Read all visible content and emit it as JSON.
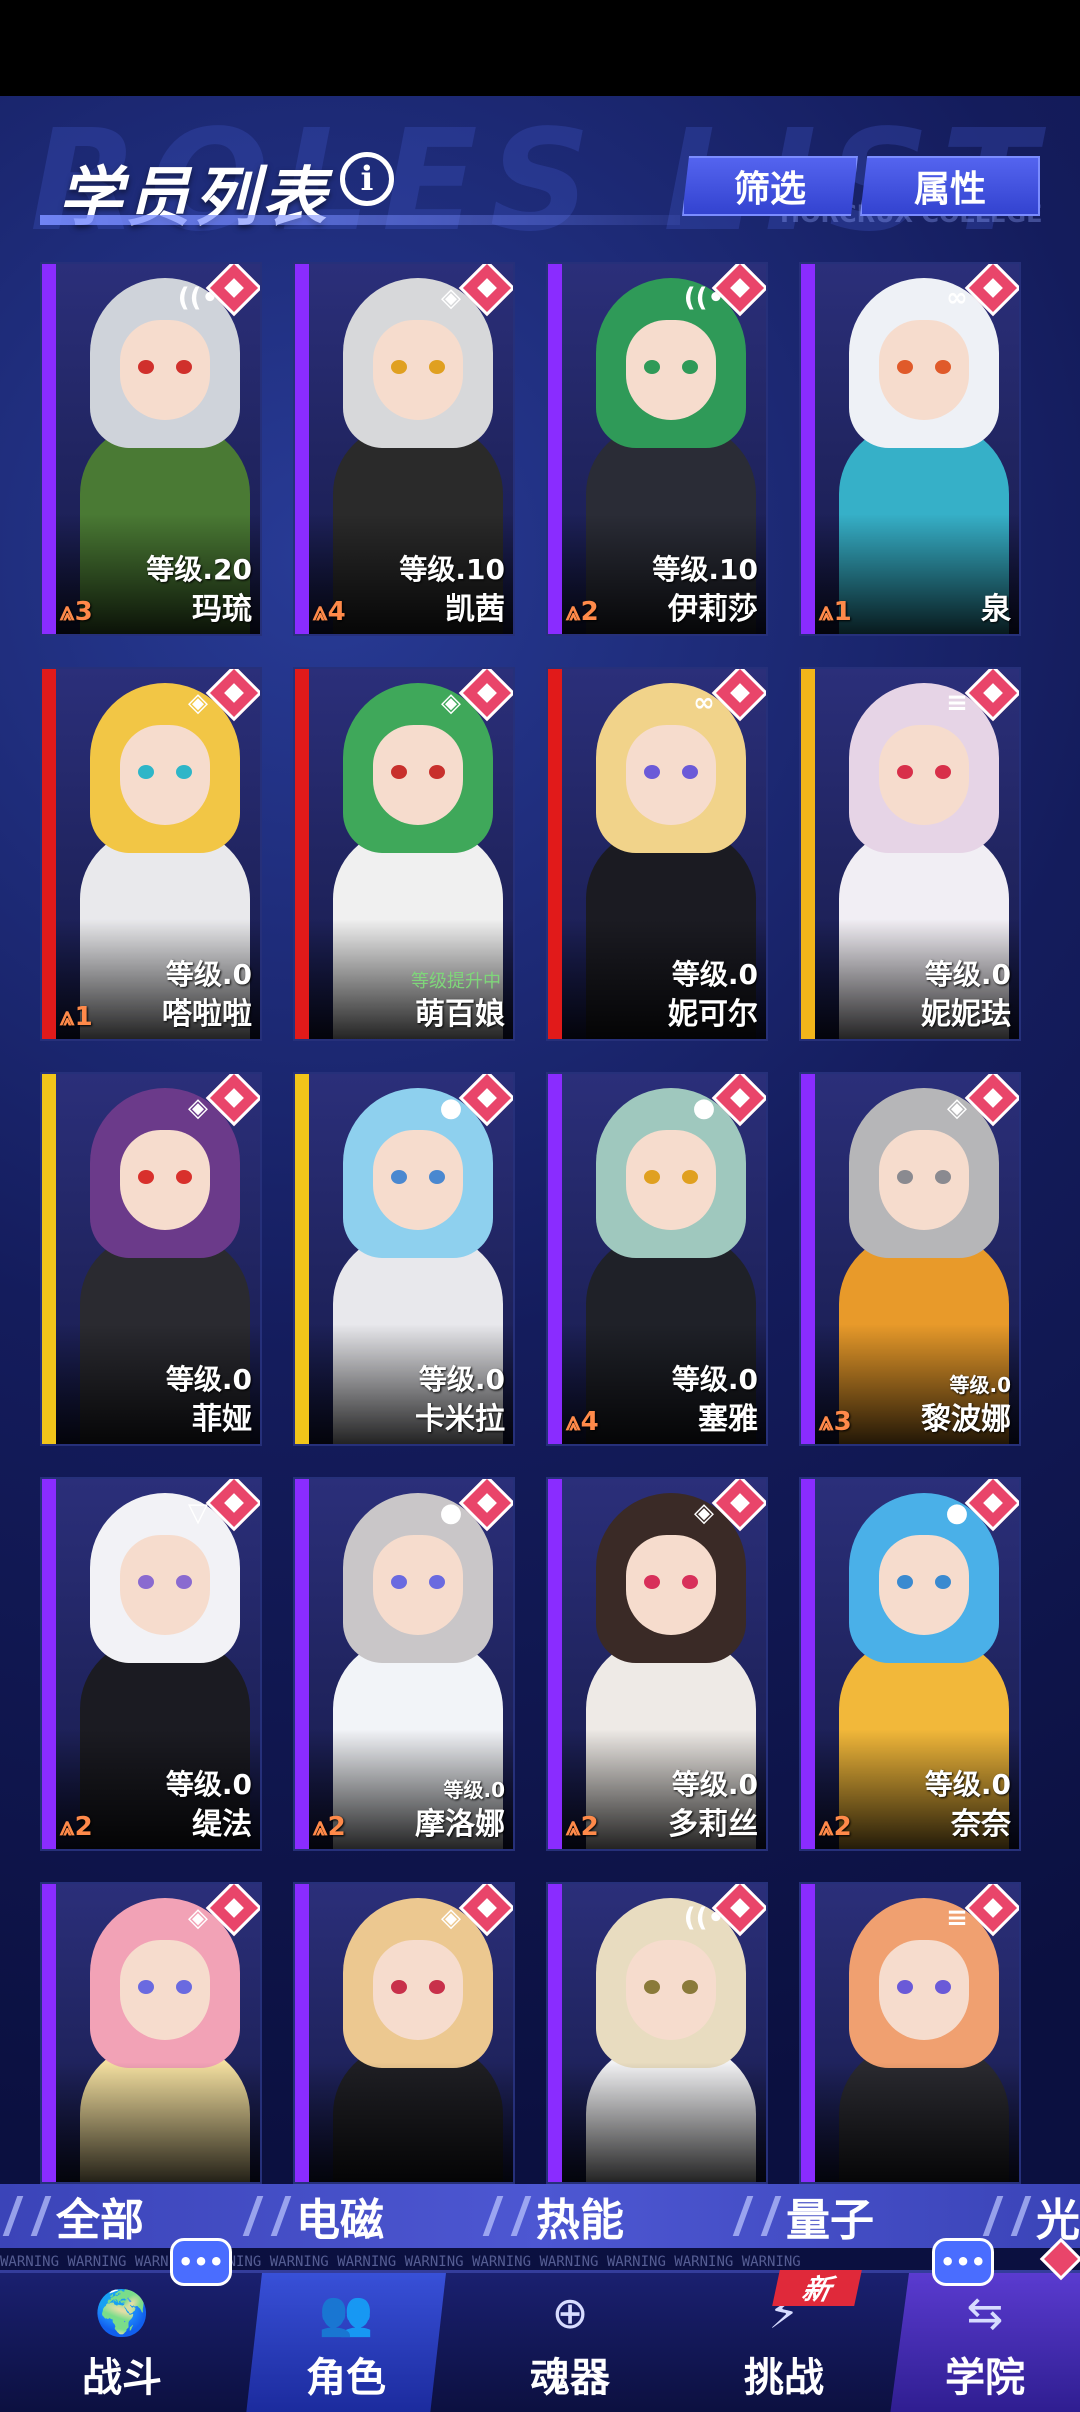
{
  "header": {
    "title": "学员列表",
    "filter_label": "筛选",
    "attribute_label": "属性",
    "bg_text": "ROLES LIST",
    "bg_college": "HORCRUX COLLEGE"
  },
  "characters": [
    {
      "name": "玛琉",
      "level": "等级.20",
      "rank": "⩓3",
      "element": "signal-icon",
      "element_glyph": "((•",
      "stripe": "#8a2cff",
      "hair": "#cfd3da",
      "eyes": "#d0302c",
      "outfit": "#4a7a34"
    },
    {
      "name": "凯茜",
      "level": "等级.10",
      "rank": "⩓4",
      "element": "diamond-icon",
      "element_glyph": "◈",
      "stripe": "#8a2cff",
      "hair": "#d7d8da",
      "eyes": "#e0a020",
      "outfit": "#2a2a2a"
    },
    {
      "name": "伊莉莎",
      "level": "等级.10",
      "rank": "⩓2",
      "element": "signal-icon",
      "element_glyph": "((•",
      "stripe": "#8a2cff",
      "hair": "#2f9a58",
      "eyes": "#2f9a58",
      "outfit": "#2a2c36"
    },
    {
      "name": "泉",
      "level": "",
      "rank": "⩓1",
      "element": "link-icon",
      "element_glyph": "∞",
      "stripe": "#8a2cff",
      "hair": "#eef1f6",
      "eyes": "#e05a2a",
      "outfit": "#36b0c8"
    },
    {
      "name": "嗒啦啦",
      "level": "等级.0",
      "rank": "⩓1",
      "element": "diamond-icon",
      "element_glyph": "◈",
      "stripe": "#e11a1a",
      "hair": "#f2c645",
      "eyes": "#2eb6c8",
      "outfit": "#e9e9ec"
    },
    {
      "name": "萌百娘",
      "level": "",
      "level_up_note": "等级提升中",
      "rank": "",
      "element": "diamond-icon",
      "element_glyph": "◈",
      "stripe": "#e11a1a",
      "hair": "#3fa85a",
      "eyes": "#c8302c",
      "outfit": "#f0f0f0"
    },
    {
      "name": "妮可尔",
      "level": "等级.0",
      "rank": "",
      "element": "link-icon",
      "element_glyph": "∞",
      "stripe": "#e11a1a",
      "hair": "#f1d38a",
      "eyes": "#6b5ad8",
      "outfit": "#1b1b22"
    },
    {
      "name": "妮妮珐",
      "level": "等级.0",
      "rank": "",
      "element": "bars-icon",
      "element_glyph": "≡",
      "stripe": "#f2b51a",
      "hair": "#e6d4e6",
      "eyes": "#d8304a",
      "outfit": "#f1eef4"
    },
    {
      "name": "菲娅",
      "level": "等级.0",
      "rank": "",
      "element": "diamond-icon",
      "element_glyph": "◈",
      "stripe": "#f2c51a",
      "hair": "#6b3a8a",
      "eyes": "#d8302c",
      "outfit": "#2a2a30"
    },
    {
      "name": "卡米拉",
      "level": "等级.0",
      "rank": "",
      "element": "drop-icon",
      "element_glyph": "●",
      "stripe": "#f2c51a",
      "hair": "#8ed0ee",
      "eyes": "#4a88d0",
      "outfit": "#e8e8ec"
    },
    {
      "name": "塞雅",
      "level": "等级.0",
      "rank": "⩓4",
      "element": "drop-icon",
      "element_glyph": "●",
      "stripe": "#8a2cff",
      "hair": "#9fc8be",
      "eyes": "#e0a020",
      "outfit": "#1f2128"
    },
    {
      "name": "黎波娜",
      "level": "等级.0",
      "rank": "⩓3",
      "element": "diamond-icon",
      "element_glyph": "◈",
      "stripe": "#8a2cff",
      "hair": "#b6b6b8",
      "eyes": "#8a8a90",
      "outfit": "#e89a2a",
      "level_small": true
    },
    {
      "name": "缇法",
      "level": "等级.0",
      "rank": "⩓2",
      "element": "triangle-icon",
      "element_glyph": "▽",
      "stripe": "#8a2cff",
      "hair": "#f2f2f6",
      "eyes": "#8a6ad0",
      "outfit": "#1b1b22"
    },
    {
      "name": "摩洛娜",
      "level": "等级.0",
      "rank": "⩓2",
      "element": "drop-icon",
      "element_glyph": "●",
      "stripe": "#8a2cff",
      "hair": "#c9c6c8",
      "eyes": "#6a6ae0",
      "outfit": "#f2f4f8",
      "level_small": true
    },
    {
      "name": "多莉丝",
      "level": "等级.0",
      "rank": "⩓2",
      "element": "diamond-icon",
      "element_glyph": "◈",
      "stripe": "#8a2cff",
      "hair": "#3a2a26",
      "eyes": "#d8305a",
      "outfit": "#eeeae6"
    },
    {
      "name": "奈奈",
      "level": "等级.0",
      "rank": "⩓2",
      "element": "drop-icon",
      "element_glyph": "●",
      "stripe": "#8a2cff",
      "hair": "#4ab0e8",
      "eyes": "#3a8ad0",
      "outfit": "#f2b83a"
    },
    {
      "name": "",
      "level": "",
      "rank": "",
      "element": "diamond-icon",
      "element_glyph": "◈",
      "stripe": "#8a2cff",
      "hair": "#f2a2b6",
      "eyes": "#6a6ae0",
      "outfit": "#f4e0a0"
    },
    {
      "name": "",
      "level": "",
      "rank": "",
      "element": "diamond-icon",
      "element_glyph": "◈",
      "stripe": "#8a2cff",
      "hair": "#ecc890",
      "eyes": "#c8304a",
      "outfit": "#1f1f24"
    },
    {
      "name": "",
      "level": "",
      "rank": "",
      "element": "signal-icon",
      "element_glyph": "((•",
      "stripe": "#8a2cff",
      "hair": "#e8dcc0",
      "eyes": "#8a7a3a",
      "outfit": "#f2f2f4"
    },
    {
      "name": "",
      "level": "",
      "rank": "",
      "element": "bars-icon",
      "element_glyph": "≡",
      "stripe": "#8a2cff",
      "hair": "#f0a070",
      "eyes": "#6a5ad8",
      "outfit": "#2a2a30"
    }
  ],
  "element_tabs": [
    {
      "label": "全部"
    },
    {
      "label": "电磁"
    },
    {
      "label": "热能"
    },
    {
      "label": "量子"
    },
    {
      "label": "光"
    }
  ],
  "warning_text": "WARNING  WARNING  WARNING  WARNING  WARNING  WARNING  WARNING  WARNING  WARNING  WARNING  WARNING  WARNING",
  "nav": {
    "battle": "战斗",
    "role": "角色",
    "soul_device": "魂器",
    "challenge": "挑战",
    "academy": "学院",
    "new_badge": "新",
    "chat_glyph": "•••"
  }
}
